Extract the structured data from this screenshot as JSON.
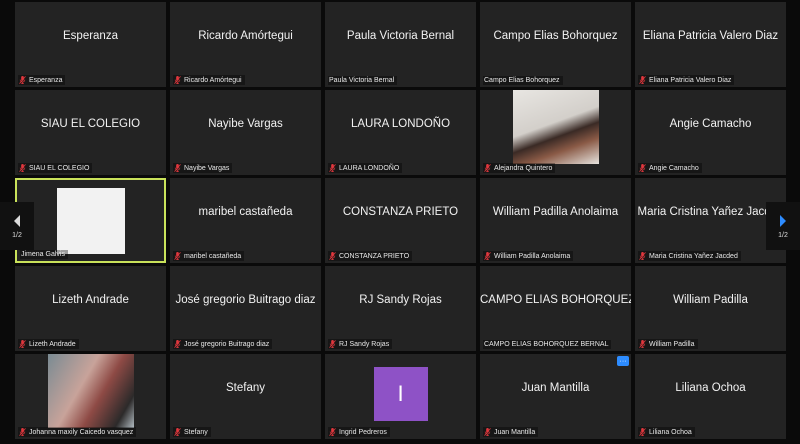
{
  "pagination": {
    "left_label": "1/2",
    "right_label": "1/2"
  },
  "colors": {
    "muted_mic": "#e0373d",
    "active_border": "#c9e25a",
    "nav_arrow_right": "#2d8cff",
    "avatar_i": "#8e52c6"
  },
  "participants": [
    {
      "name": "Esperanza",
      "center": "Esperanza"
    },
    {
      "name": "Ricardo Amórtegui",
      "center": "Ricardo Amórtegui"
    },
    {
      "name": "Paula Victoria Bernal",
      "center": "Paula Victoria Bernal"
    },
    {
      "name": "Campo Elias Bohorquez",
      "center": "Campo Elias Bohorquez"
    },
    {
      "name": "Eliana Patricia Valero Diaz",
      "center": "Eliana Patricia Valero Diaz"
    },
    {
      "name": "SIAU EL COLEGIO",
      "center": "SIAU EL COLEGIO"
    },
    {
      "name": "Nayibe Vargas",
      "center": "Nayibe Vargas"
    },
    {
      "name": "LAURA LONDOÑO",
      "center": "LAURA LONDOÑO"
    },
    {
      "name": "Alejandra Quintero"
    },
    {
      "name": "Angie Camacho",
      "center": "Angie Camacho"
    },
    {
      "name": "Jimena Galvis"
    },
    {
      "name": "maribel castañeda",
      "center": "maribel castañeda"
    },
    {
      "name": "CONSTANZA PRIETO",
      "center": "CONSTANZA PRIETO"
    },
    {
      "name": "William Padilla Anolaima",
      "center": "William Padilla Anolaima"
    },
    {
      "name": "Maria Cristina Yañez Jacded",
      "center": "Maria Cristina Yañez Jacded"
    },
    {
      "name": "Lizeth Andrade",
      "center": "Lizeth Andrade"
    },
    {
      "name": "José gregorio Buitrago diaz",
      "center": "José gregorio Buitrago diaz"
    },
    {
      "name": "RJ Sandy Rojas",
      "center": "RJ Sandy Rojas"
    },
    {
      "name": "CAMPO ELIAS BOHORQUEZ BERNAL",
      "center": "CAMPO ELIAS BOHORQUEZ BERNAL"
    },
    {
      "name": "William Padilla",
      "center": "William Padilla"
    },
    {
      "name": "Johanna maxily Caicedo vasquez"
    },
    {
      "name": "Stefany",
      "center": "Stefany"
    },
    {
      "name": "Ingrid Pedreros",
      "avatar_letter": "I"
    },
    {
      "name": "Juan Mantilla",
      "center": "Juan Mantilla",
      "more_menu": "···"
    },
    {
      "name": "Liliana Ochoa",
      "center": "Liliana Ochoa"
    }
  ]
}
